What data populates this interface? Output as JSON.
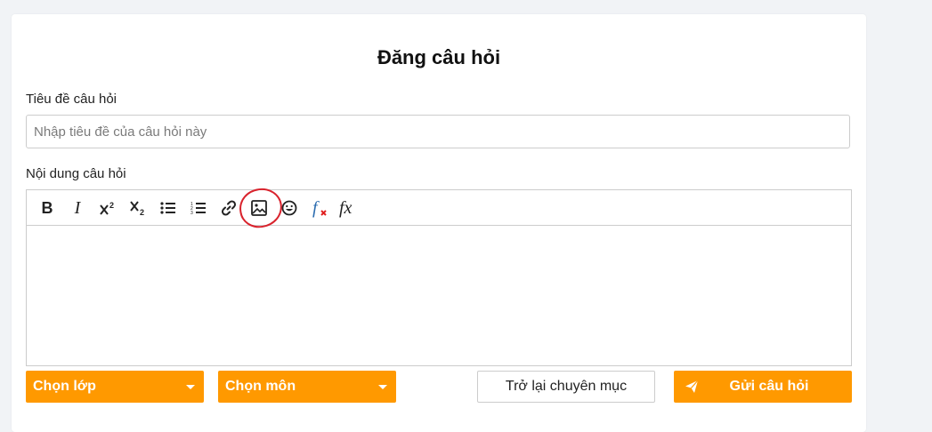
{
  "page": {
    "title": "Đăng câu hỏi"
  },
  "form": {
    "title_label": "Tiêu đề câu hỏi",
    "title_placeholder": "Nhập tiêu đề của câu hỏi này",
    "title_value": "",
    "content_label": "Nội dung câu hỏi"
  },
  "toolbar": {
    "items": [
      {
        "name": "bold",
        "icon": "bold-icon",
        "text": "B"
      },
      {
        "name": "italic",
        "icon": "italic-icon",
        "text": "I"
      },
      {
        "name": "superscript",
        "icon": "superscript-icon"
      },
      {
        "name": "subscript",
        "icon": "subscript-icon"
      },
      {
        "name": "bulleted-list",
        "icon": "bulleted-list-icon"
      },
      {
        "name": "numbered-list",
        "icon": "numbered-list-icon"
      },
      {
        "name": "link",
        "icon": "link-icon"
      },
      {
        "name": "image",
        "icon": "image-icon",
        "highlighted": true
      },
      {
        "name": "emoji",
        "icon": "emoji-icon"
      },
      {
        "name": "math-remove",
        "icon": "formula-remove-icon"
      },
      {
        "name": "math",
        "icon": "formula-icon"
      }
    ]
  },
  "actions": {
    "class_select": "Chọn lớp",
    "subject_select": "Chọn môn",
    "back_label": "Trở lại chuyên mục",
    "submit_label": "Gửi câu hỏi"
  },
  "colors": {
    "accent": "#ff9900",
    "highlight": "#d9232d",
    "formula_blue": "#2b6cb0",
    "formula_red": "#e02020"
  }
}
